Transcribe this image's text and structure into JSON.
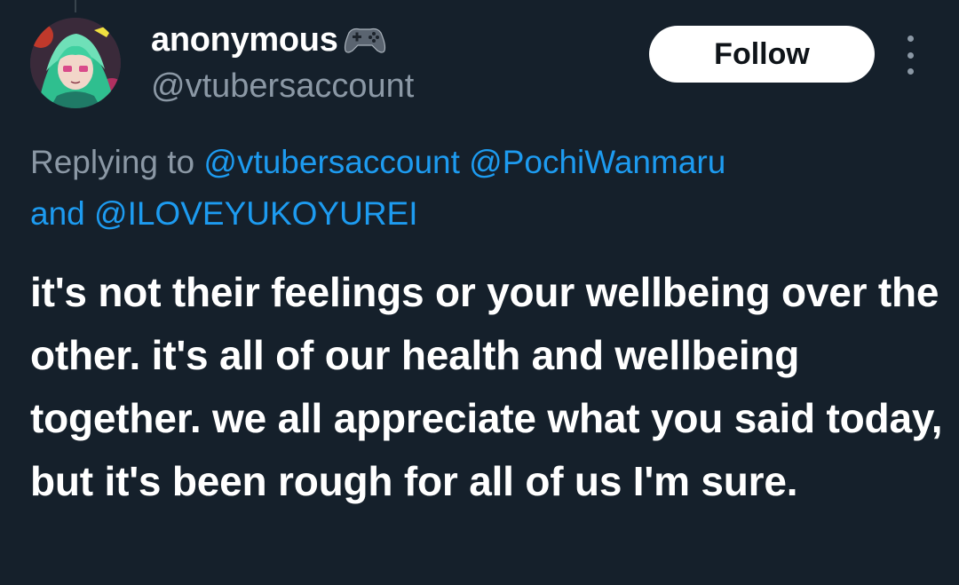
{
  "theme": {
    "background": "#15202b",
    "primary_text": "#ffffff",
    "secondary_text": "#8b98a5",
    "link": "#1d9bf0",
    "button_bg": "#ffffff",
    "button_text": "#0f1419"
  },
  "author": {
    "display_name": "anonymous",
    "name_emoji_icon": "video-game-controller-icon",
    "handle": "@vtubersaccount",
    "avatar_icon": "anime-avatar-green-hair"
  },
  "actions": {
    "follow_label": "Follow",
    "more_icon": "more-vertical-icon"
  },
  "reply_context": {
    "prefix": "Replying to",
    "mentions": [
      "@vtubersaccount",
      "@PochiWanmaru",
      "@ILOVEYUKOYUREI"
    ],
    "conjunction": "and"
  },
  "tweet": {
    "text": "it's not their feelings or your wellbeing over the other. it's all of our health and wellbeing together. we all appreciate what you said today, but it's been rough for all of us I'm sure."
  }
}
